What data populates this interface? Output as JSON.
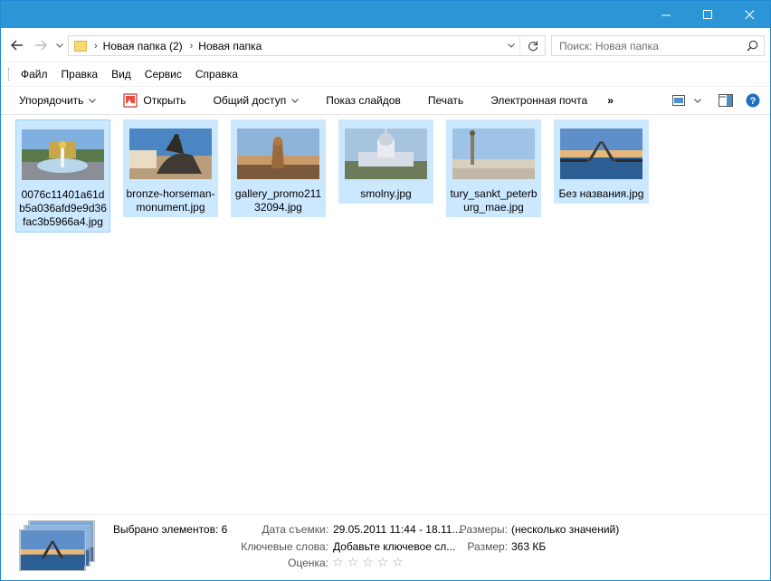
{
  "colors": {
    "titlebar": "#2b95d6",
    "selection": "#cce8ff",
    "selection_border": "#99d1ff"
  },
  "navigation": {
    "back_icon": "arrow-left-icon",
    "forward_icon": "arrow-right-icon",
    "breadcrumb": [
      "Новая папка (2)",
      "Новая папка"
    ]
  },
  "search": {
    "placeholder": "Поиск: Новая папка"
  },
  "menu": {
    "items": [
      "Файл",
      "Правка",
      "Вид",
      "Сервис",
      "Справка"
    ]
  },
  "commands": {
    "organize": "Упорядочить",
    "open": "Открыть",
    "share": "Общий доступ",
    "slideshow": "Показ слайдов",
    "print": "Печать",
    "email": "Электронная почта",
    "more": "»"
  },
  "files": [
    {
      "name": "0076c11401a61db5a036afd9e9d36fac3b5966a4.jpg",
      "selected_focus": true
    },
    {
      "name": "bronze-horseman-monument.jpg"
    },
    {
      "name": "gallery_promo21132094.jpg"
    },
    {
      "name": "smolny.jpg"
    },
    {
      "name": "tury_sankt_peterburg_mae.jpg"
    },
    {
      "name": "Без названия.jpg"
    }
  ],
  "details": {
    "selected_count": "Выбрано элементов: 6",
    "date_label": "Дата съемки:",
    "date_value": "29.05.2011 11:44 - 18.11....",
    "dims_label": "Размеры:",
    "dims_value": "(несколько значений)",
    "tags_label": "Ключевые слова:",
    "tags_value": "Добавьте ключевое сл...",
    "size_label": "Размер:",
    "size_value": "363 КБ",
    "rating_label": "Оценка:",
    "rating": 0
  }
}
